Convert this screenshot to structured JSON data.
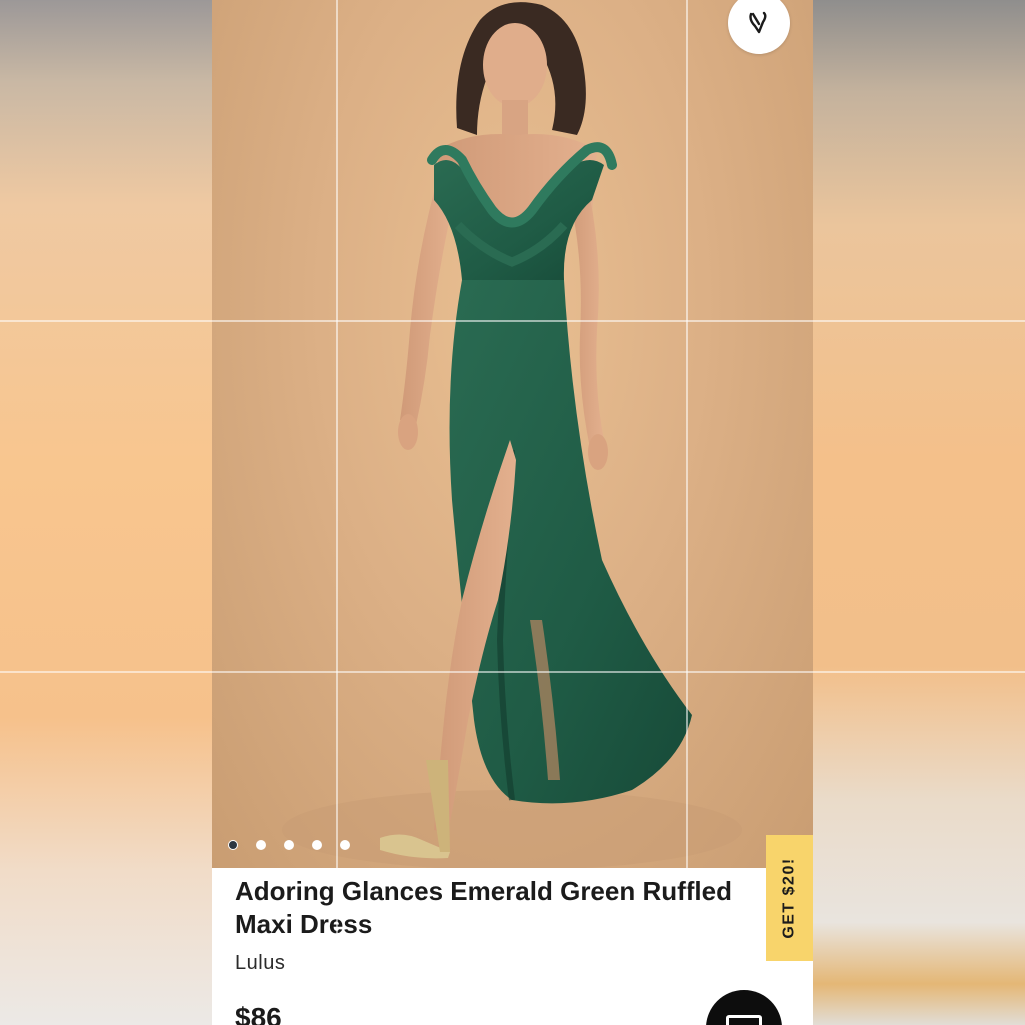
{
  "product": {
    "title": "Adoring Glances Emerald Green Ruffled Maxi Dress",
    "brand": "Lulus",
    "price": "$86"
  },
  "gallery": {
    "image_count": 5,
    "active_index": 0
  },
  "promo": {
    "label": "GET $20!"
  },
  "icons": {
    "favorite": "heart-icon",
    "chat": "chat-icon"
  },
  "colors": {
    "dress": "#1f5b45",
    "promo_bg": "#f8d46b",
    "backdrop": "#dcb086"
  }
}
